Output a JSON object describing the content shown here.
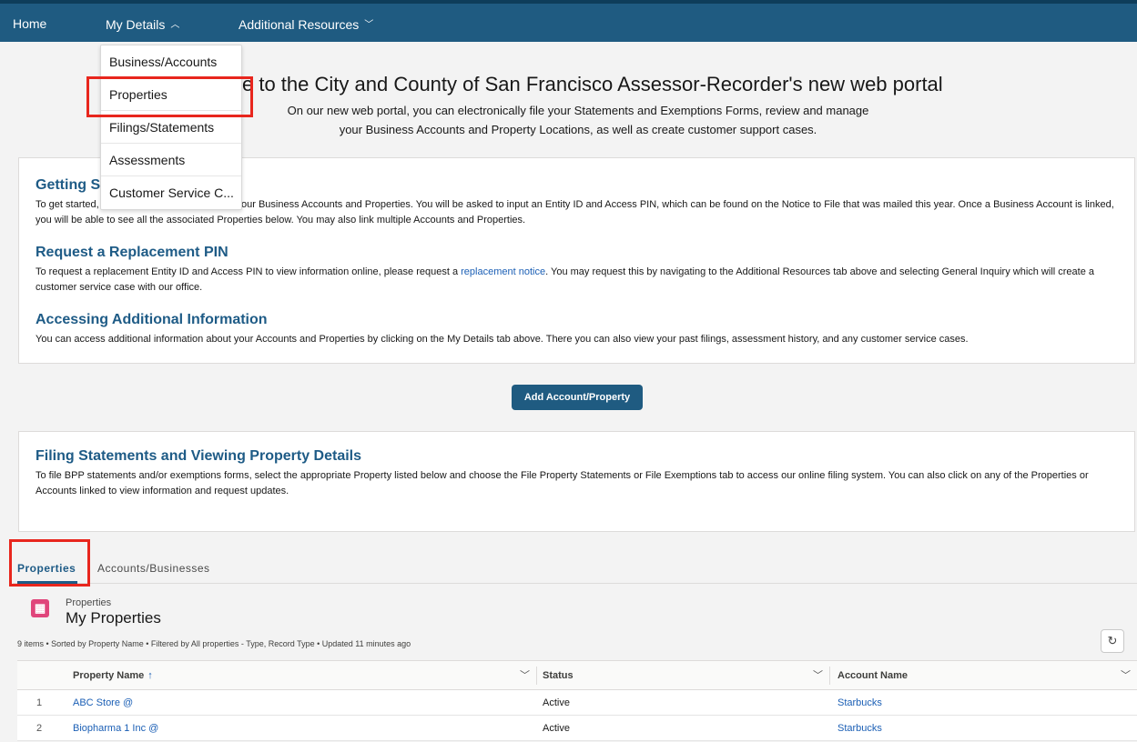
{
  "nav": {
    "home": "Home",
    "my_details": "My Details",
    "additional_resources": "Additional Resources",
    "caret_up": "⌃",
    "caret_down": "⌄"
  },
  "my_details_menu": [
    "Business/Accounts",
    "Properties",
    "Filings/Statements",
    "Assessments",
    "Customer Service C..."
  ],
  "welcome": {
    "title": "Welcome to the City and County of San Francisco Assessor-Recorder's new web portal",
    "title_visible": "e to the City and County of San Francisco Assessor-Recorder's new web portal",
    "subtitle_line1": "On our new web portal, you can electronically file your Statements and Exemptions Forms, review and manage",
    "subtitle_line2": "your Business Accounts and Property Locations, as well as create customer support cases."
  },
  "getting_started": {
    "heading": "Getting St",
    "text_line1_left": "To get started,",
    "text_line1_right": "our Business Accounts and Properties. You will be asked to input an Entity ID and Access PIN, which can be found on the Notice to File that was mailed this year. Once a Business Account is linked,",
    "text_line2": "you will be able to see all the associated Properties below. You may also link multiple Accounts and Properties."
  },
  "replacement_pin": {
    "heading": "Request a Replacement PIN",
    "text_before_link": "To request a replacement Entity ID and Access PIN to view information online, please request a ",
    "link": "replacement notice",
    "text_after_link": ". You may request this by navigating to the Additional Resources tab above and selecting General Inquiry which will create a",
    "text_line2": "customer service case with our office."
  },
  "additional_info": {
    "heading": "Accessing Additional Information",
    "text": "You can access additional information about your Accounts and Properties by clicking on the My Details tab above. There you can also view your past filings, assessment history, and any customer service cases."
  },
  "add_button": "Add Account/Property",
  "filing": {
    "heading": "Filing Statements and Viewing Property Details",
    "text_line1": "To file BPP statements and/or exemptions forms, select the appropriate Property listed below and choose the File Property Statements or File Exemptions tab to access our online filing system. You can also click on any of the Properties or",
    "text_line2": "Accounts linked to view information and request updates."
  },
  "tabs": [
    "Properties",
    "Accounts/Businesses"
  ],
  "list_view": {
    "object_type": "Properties",
    "title": "My Properties",
    "icon_glyph": "▦",
    "meta": "9 items • Sorted by Property Name • Filtered by All properties - Type, Record Type • Updated 11 minutes ago",
    "refresh_glyph": "↻",
    "columns": [
      "Property Name",
      "Status",
      "Account Name"
    ],
    "sort_arrow": "↑",
    "rows": [
      {
        "num": "1",
        "property_name": "ABC Store @",
        "status": "Active",
        "account_name": "Starbucks"
      },
      {
        "num": "2",
        "property_name": "Biopharma 1 Inc @",
        "status": "Active",
        "account_name": "Starbucks"
      }
    ]
  },
  "colors": {
    "nav_bg": "#1f5b81",
    "heading_blue": "#1e5b86",
    "link_blue": "#1b5fb5",
    "highlight_red": "#e8261d",
    "icon_pink": "#e0457b"
  }
}
